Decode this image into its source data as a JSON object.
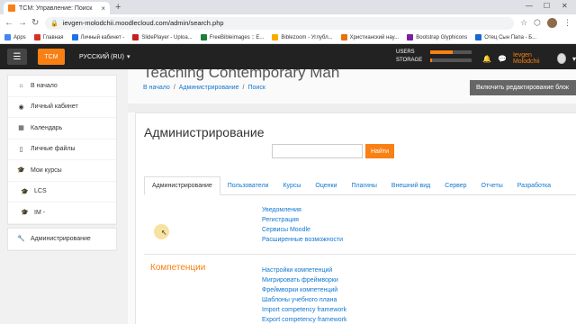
{
  "browser": {
    "tab_title": "TCM: Управление: Поиск",
    "url": "ievgen-molodchii.moodlecloud.com/admin/search.php",
    "bookmarks": [
      {
        "label": "Apps",
        "color": "#4285f4"
      },
      {
        "label": "Главная",
        "color": "#d93025"
      },
      {
        "label": "Личный кабинет -",
        "color": "#1a73e8"
      },
      {
        "label": "SlidePlayer - Uploa...",
        "color": "#c5221f"
      },
      {
        "label": "FreeBibleimages :: E...",
        "color": "#188038"
      },
      {
        "label": "Biblezoom - Углубл...",
        "color": "#f9ab00"
      },
      {
        "label": "Христианский наy...",
        "color": "#e8710a"
      },
      {
        "label": "Bootstrap Glyphicons",
        "color": "#7b1fa2"
      },
      {
        "label": "Отец Сын Папа - Б...",
        "color": "#1967d2"
      }
    ]
  },
  "navbar": {
    "brand": "TCM",
    "language": "РУССКИЙ (RU)",
    "users_label": "USERS",
    "storage_label": "STORAGE",
    "users_fraction": 0.55,
    "storage_fraction": 0.05,
    "users_color": "#f98012",
    "storage_color": "#f98012",
    "user_name": "Ievgen Molodchii"
  },
  "drawer": {
    "group1": [
      {
        "label": "В начало",
        "icon": "home-icon"
      },
      {
        "label": "Личный кабинет",
        "icon": "dashboard-icon"
      },
      {
        "label": "Календарь",
        "icon": "calendar-icon"
      },
      {
        "label": "Личные файлы",
        "icon": "file-icon"
      },
      {
        "label": "Мои курсы",
        "icon": "graduation-cap-icon"
      },
      {
        "label": "LCS",
        "icon": "graduation-cap-icon"
      },
      {
        "label": "IM -",
        "icon": "graduation-cap-icon"
      }
    ],
    "group2": [
      {
        "label": "Администрирование",
        "icon": "wrench-icon"
      }
    ]
  },
  "page": {
    "course_title": "Teaching Contemporary Man",
    "breadcrumb": [
      "В начало",
      "Администрирование",
      "Поиск"
    ],
    "edit_button": "Включить редактирование блок",
    "heading": "Администрирование",
    "search_placeholder": "",
    "search_button": "Найти",
    "tabs": [
      "Администрирование",
      "Пользователи",
      "Курсы",
      "Оценки",
      "Плагины",
      "Внешний вид",
      "Сервер",
      "Отчеты",
      "Разработка"
    ],
    "links_group1": [
      "Уведомления",
      "Регистрация",
      "Сервисы Moodle",
      "Расширенные возможности"
    ],
    "section2_title": "Компетенции",
    "links_group2": [
      "Настройки компетенций",
      "Мигрировать фреймворки",
      "Фреймворки компетенций",
      "Шаблоны учебного плана",
      "Import competency framework",
      "Export competency framework"
    ]
  }
}
